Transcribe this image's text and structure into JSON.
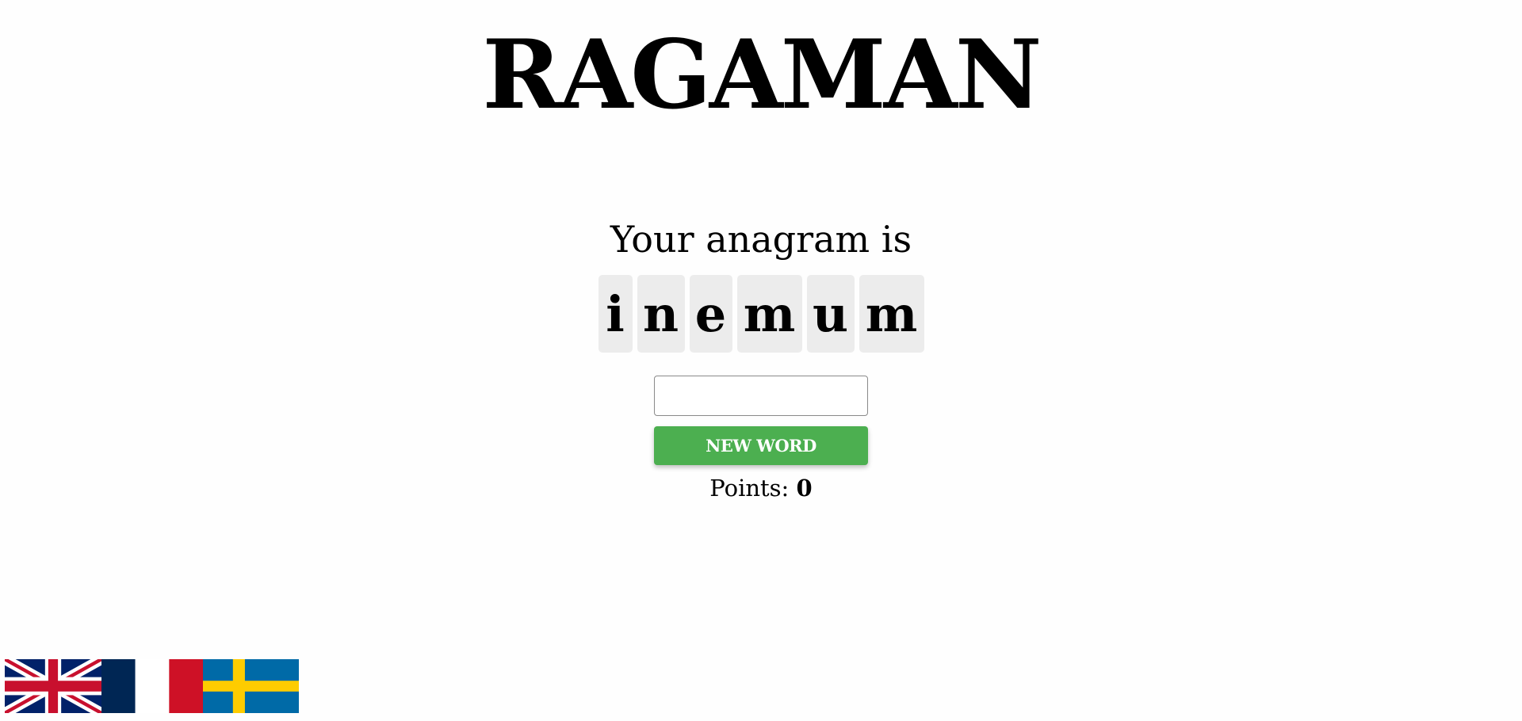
{
  "app": {
    "title": "RAGAMAN"
  },
  "game": {
    "prompt": "Your anagram is",
    "letters": [
      "i",
      "n",
      "e",
      "m",
      "u",
      "m"
    ],
    "input_value": "",
    "new_word_label": "NEW WORD",
    "points_label": "Points:",
    "points_value": "0"
  },
  "languages": [
    {
      "name": "english-flag-icon"
    },
    {
      "name": "french-flag-icon"
    },
    {
      "name": "swedish-flag-icon"
    }
  ],
  "colors": {
    "button_green": "#4caf50",
    "tile_background": "#ececec"
  }
}
